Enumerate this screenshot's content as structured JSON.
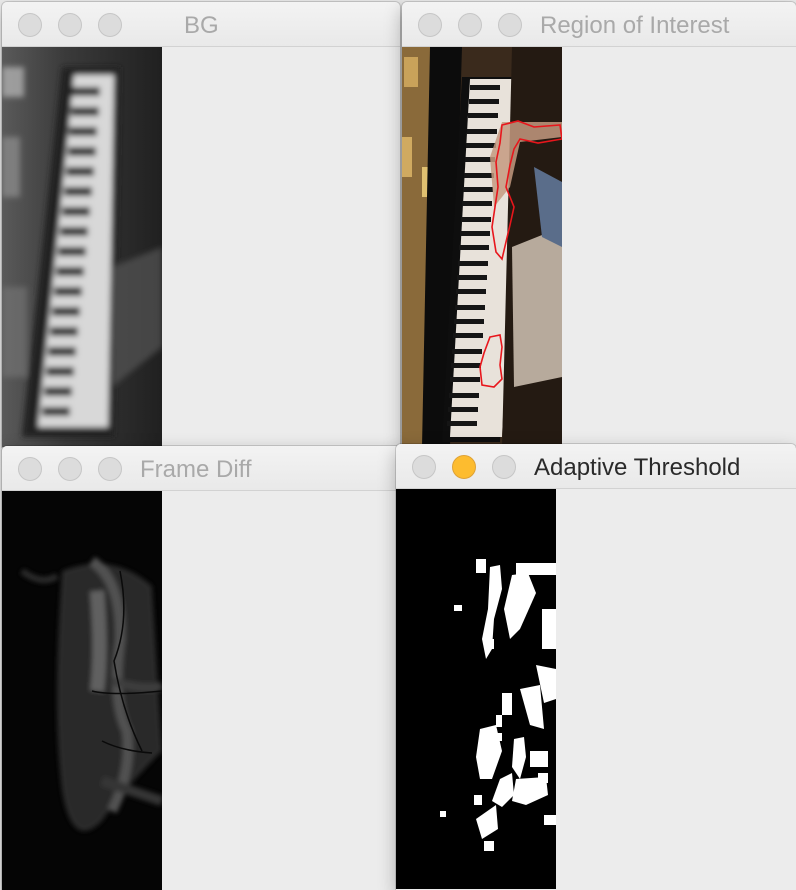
{
  "windows": {
    "bg": {
      "title": "BG",
      "image": "blurred grayscale background frame of piano keyboard"
    },
    "roi": {
      "title": "Region of Interest",
      "image": "color frame of piano keyboard with hand regions outlined",
      "outline_color": "#e8161c"
    },
    "diff": {
      "title": "Frame Diff",
      "image": "dark grayscale frame difference image"
    },
    "thresh": {
      "title": "Adaptive Threshold",
      "image": "binary black and white threshold mask"
    }
  },
  "colors": {
    "traffic_inactive": "#dcdcdc",
    "traffic_minimize_active": "#fdbc2f",
    "title_inactive": "#a9a9a9",
    "title_active": "#2a2a2a"
  }
}
